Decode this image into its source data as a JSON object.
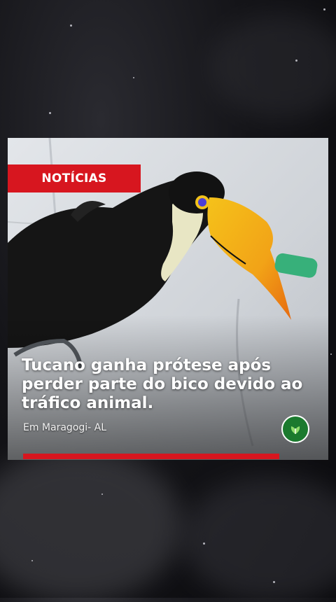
{
  "post": {
    "badge": "NOTÍCIAS",
    "headline": "Tucano ganha prótese após perder parte do bico devido ao tráfico animal.",
    "location": "Em Maragogi- AL"
  },
  "logo": {
    "icon": "leaf-logo-icon",
    "color": "#1b7a2e"
  },
  "colors": {
    "accent": "#d7161f",
    "background": "#141418"
  }
}
